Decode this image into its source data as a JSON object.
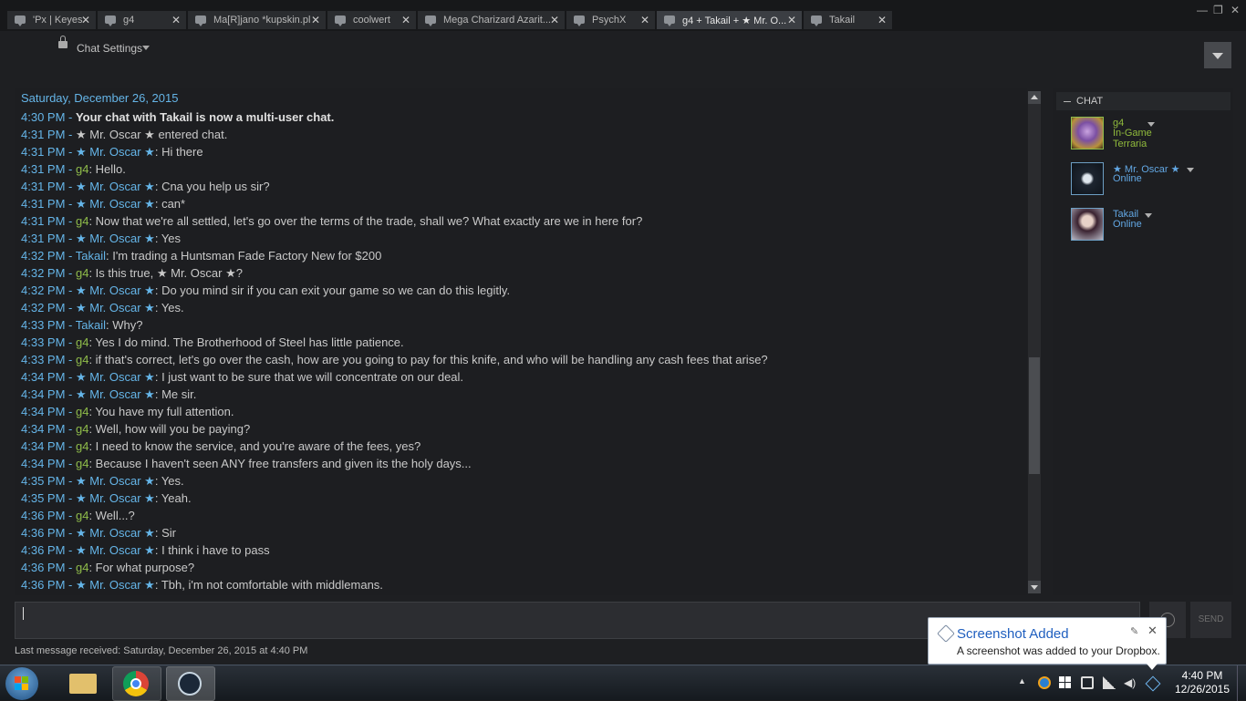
{
  "tabs": [
    {
      "label": "'Px | Keyes",
      "active": false
    },
    {
      "label": "g4",
      "active": false
    },
    {
      "label": "Ma[R]jano *kupskin.pl",
      "active": false
    },
    {
      "label": "coolwert",
      "active": false
    },
    {
      "label": "Mega Charizard Azarit...",
      "active": false
    },
    {
      "label": "PsychX",
      "active": false
    },
    {
      "label": "g4 + Takail + ★ Mr. O...",
      "active": true
    },
    {
      "label": "Takail",
      "active": false
    }
  ],
  "tab_close_glyph": "✕",
  "window_controls": {
    "minimize": "—",
    "maximize": "❐",
    "close": "✕"
  },
  "toolbar": {
    "chat_settings_label": "Chat Settings"
  },
  "chat": {
    "date_header": "Saturday, December 26, 2015",
    "messages": [
      {
        "time": "4:30 PM - ",
        "name": "",
        "text": "Your chat with Takail is now a multi-user chat.",
        "bold": true
      },
      {
        "time": "4:31 PM - ",
        "name": "",
        "text": "★ Mr. Oscar ★ entered chat."
      },
      {
        "time": "4:31 PM - ",
        "name": "★ Mr. Oscar ★",
        "text": ": Hi there"
      },
      {
        "time": "4:31 PM - ",
        "name": "g4",
        "text": ": Hello."
      },
      {
        "time": "4:31 PM - ",
        "name": "★ Mr. Oscar ★",
        "text": ": Cna you help us sir?"
      },
      {
        "time": "4:31 PM - ",
        "name": "★ Mr. Oscar ★",
        "text": ": can*"
      },
      {
        "time": "4:31 PM - ",
        "name": "g4",
        "text": ": Now that we're all settled, let's go over the terms of the trade, shall we? What exactly are we in here for?"
      },
      {
        "time": "4:31 PM - ",
        "name": "★ Mr. Oscar ★",
        "text": ": Yes"
      },
      {
        "time": "4:32 PM - ",
        "name": "Takail",
        "text": ": I'm trading a Huntsman Fade Factory New for $200"
      },
      {
        "time": "4:32 PM - ",
        "name": "g4",
        "text": ": Is this true, ★ Mr. Oscar ★?"
      },
      {
        "time": "4:32 PM - ",
        "name": "★ Mr. Oscar ★",
        "text": ": Do you mind sir if you can exit your game so we can do this legitly."
      },
      {
        "time": "4:32 PM - ",
        "name": "★ Mr. Oscar ★",
        "text": ": Yes."
      },
      {
        "time": "4:33 PM - ",
        "name": "Takail",
        "text": ": Why?"
      },
      {
        "time": "4:33 PM - ",
        "name": "g4",
        "text": ": Yes I do mind. The Brotherhood of Steel has little patience."
      },
      {
        "time": "4:33 PM - ",
        "name": "g4",
        "text": ": if that's correct, let's go over the cash, how are you going to pay for this knife, and who will be handling any cash fees that arise?"
      },
      {
        "time": "4:34 PM - ",
        "name": "★ Mr. Oscar ★",
        "text": ": I just want to be sure that we will concentrate on our deal."
      },
      {
        "time": "4:34 PM - ",
        "name": "★ Mr. Oscar ★",
        "text": ": Me sir."
      },
      {
        "time": "4:34 PM - ",
        "name": "g4",
        "text": ": You have my full attention."
      },
      {
        "time": "4:34 PM - ",
        "name": "g4",
        "text": ": Well, how will you be paying?"
      },
      {
        "time": "4:34 PM - ",
        "name": "g4",
        "text": ": I need to know the service, and you're aware of the fees, yes?"
      },
      {
        "time": "4:34 PM - ",
        "name": "g4",
        "text": ": Because I haven't seen ANY free transfers and given its the holy days..."
      },
      {
        "time": "4:35 PM - ",
        "name": "★ Mr. Oscar ★",
        "text": ": Yes."
      },
      {
        "time": "4:35 PM - ",
        "name": "★ Mr. Oscar ★",
        "text": ": Yeah."
      },
      {
        "time": "4:36 PM - ",
        "name": "g4",
        "text": ": Well...?"
      },
      {
        "time": "4:36 PM - ",
        "name": "★ Mr. Oscar ★",
        "text": ": Sir"
      },
      {
        "time": "4:36 PM - ",
        "name": "★ Mr. Oscar ★",
        "text": ": I think i have to pass"
      },
      {
        "time": "4:36 PM - ",
        "name": "g4",
        "text": ": For what purpose?"
      },
      {
        "time": "4:36 PM - ",
        "name": "★ Mr. Oscar ★",
        "text": ": Tbh, i'm not comfortable with middlemans."
      }
    ],
    "input_value": "",
    "send_label": "SEND",
    "last_message": "Last message received: Saturday, December 26, 2015 at 4:40 PM"
  },
  "members": {
    "header": "CHAT",
    "list": [
      {
        "name": "g4",
        "status": "In-Game",
        "game": "Terraria",
        "status_type": "ingame"
      },
      {
        "name": "★ Mr. Oscar ★",
        "status": "Online",
        "game": "",
        "status_type": "online"
      },
      {
        "name": "Takail",
        "status": "Online",
        "game": "",
        "status_type": "online"
      }
    ]
  },
  "toast": {
    "title": "Screenshot Added",
    "body": "A screenshot was added to your Dropbox.",
    "close_glyph": "✕",
    "settings_glyph": "✎"
  },
  "taskbar": {
    "clock_time": "4:40 PM",
    "clock_date": "12/26/2015",
    "apps": [
      "windows-explorer",
      "google-chrome",
      "steam"
    ]
  },
  "colors": {
    "timestamp": "#65b5e8",
    "name_g4": "#8fbc4a",
    "name_other": "#65b5e8",
    "in_game": "#90ba3c",
    "online": "#62a7e3"
  }
}
